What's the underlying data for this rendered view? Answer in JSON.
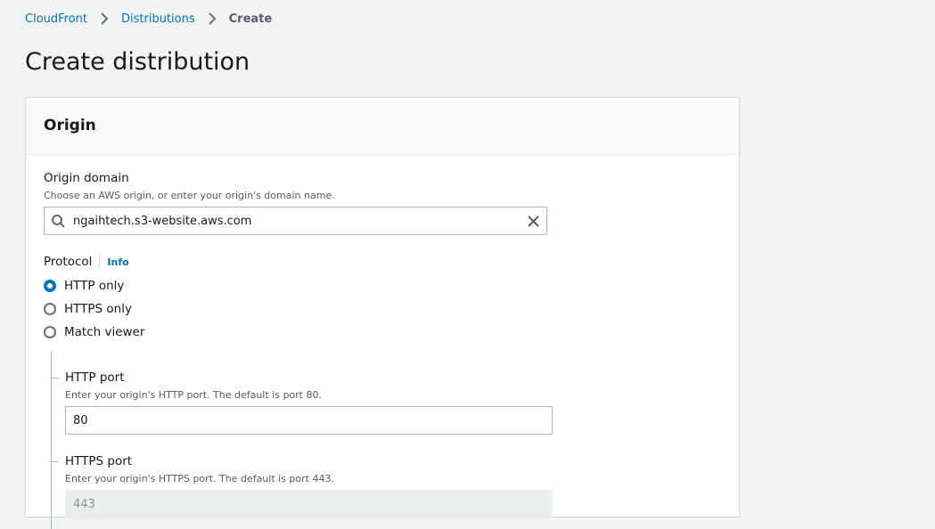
{
  "breadcrumb": {
    "items": [
      "CloudFront",
      "Distributions"
    ],
    "current": "Create"
  },
  "page": {
    "title": "Create distribution"
  },
  "origin_section": {
    "title": "Origin",
    "origin_domain": {
      "label": "Origin domain",
      "description": "Choose an AWS origin, or enter your origin's domain name.",
      "value": "ngaihtech.s3-website.aws.com"
    },
    "protocol": {
      "label": "Protocol",
      "info": "Info",
      "options": [
        "HTTP only",
        "HTTPS only",
        "Match viewer"
      ],
      "selected": "HTTP only"
    },
    "http_port": {
      "label": "HTTP port",
      "description": "Enter your origin's HTTP port. The default is port 80.",
      "value": "80"
    },
    "https_port": {
      "label": "HTTPS port",
      "description": "Enter your origin's HTTPS port. The default is port 443.",
      "value": "443"
    }
  },
  "colors": {
    "link": "#0073bb",
    "selected_radio": "#0073bb"
  }
}
